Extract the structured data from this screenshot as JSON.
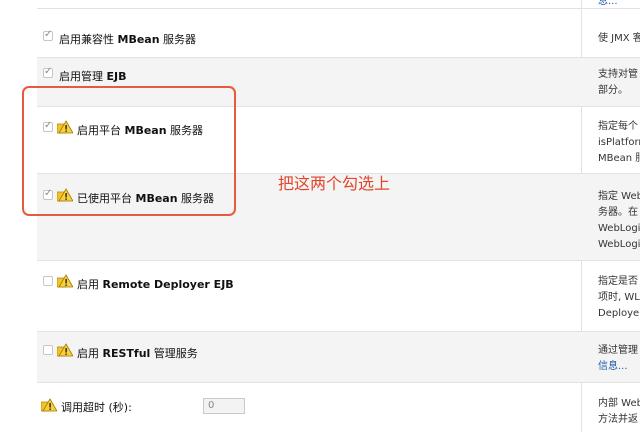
{
  "top_desc": "息...",
  "rows": [
    {
      "label": "启用兼容性 MBean 服务器",
      "checked": true,
      "warning": false,
      "desc": [
        "使 JMX 客"
      ]
    },
    {
      "label": "启用管理 EJB",
      "checked": true,
      "warning": false,
      "desc": [
        "支持对管",
        "部分。"
      ]
    },
    {
      "label": "启用平台 MBean 服务器",
      "checked": true,
      "warning": true,
      "desc": [
        "指定每个",
        "isPlatform",
        "MBean 服"
      ]
    },
    {
      "label": "已使用平台 MBean 服务器",
      "checked": true,
      "warning": true,
      "desc": [
        "指定 Web",
        "务器。在",
        "WebLogi",
        "WebLogi"
      ]
    },
    {
      "label": "启用 Remote Deployer EJB",
      "checked": false,
      "warning": true,
      "desc": [
        "指定是否",
        "项时, WL",
        "Deployer"
      ]
    },
    {
      "label": "启用 RESTful 管理服务",
      "checked": false,
      "warning": true,
      "desc": [
        "通过管理"
      ],
      "desc_link": "信息..."
    },
    {
      "label": "调用超时 (秒):",
      "warning": true,
      "desc": [
        "内部 Web",
        "方法并返"
      ]
    }
  ],
  "timeout_value": "0",
  "annotation": "把这两个勾选上",
  "colors": {
    "highlight": "#e85a3c",
    "annotation": "#e2472c",
    "link": "#1f5aa6",
    "warning": "#f2c12e"
  }
}
